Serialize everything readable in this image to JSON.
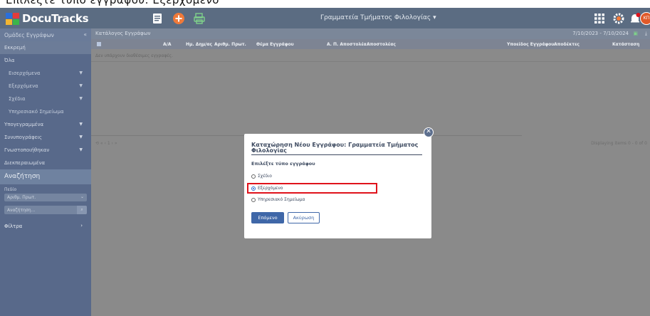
{
  "caption": "Επιλέξτε τύπο εγγράφου: Εξερχόμενο",
  "app": {
    "name": "DocuTracks",
    "department": "Γραμματεία Τμήματος Φιλολογίας ▾",
    "avatar": "ΚΠ"
  },
  "sidebar": {
    "header": "Ομάδες Εγγράφων",
    "items": [
      {
        "label": "Εκκρεμή",
        "active": true
      },
      {
        "label": "Όλα"
      },
      {
        "label": "Εισερχόμενα",
        "sub": true
      },
      {
        "label": "Εξερχόμενα",
        "sub": true
      },
      {
        "label": "Σχέδια",
        "sub": true
      },
      {
        "label": "Υπηρεσιακό Σημείωμα",
        "sub": true
      },
      {
        "label": "Υπογεγραμμένα"
      },
      {
        "label": "Συνυπογράφεις"
      },
      {
        "label": "Γνωστοποιήθηκαν"
      },
      {
        "label": "Διεκπεραιωμένα"
      }
    ],
    "search_section": "Αναζήτηση",
    "field_label": "Πεδίο",
    "field_select": "Αριθμ. Πρωτ.",
    "search_placeholder": "Αναζήτηση...",
    "filters": "Φίλτρα"
  },
  "main": {
    "title": "Κατάλογος Εγγράφων",
    "date_range": "7/10/2023 - 7/10/2024",
    "columns": [
      "Α/Α",
      "Ημ. Δημ/ας",
      "Αριθμ. Πρωτ.",
      "Θέμα Εγγράφου",
      "Α. Π. Αποστολέα",
      "Αποστολέας",
      "Υποείδος Εγγράφου",
      "Αποδέκτες",
      "Κατάσταση"
    ],
    "empty_message": "Δεν υπάρχουν διαθέσιμες εγγραφές.",
    "pager": "⟲  «  ‹  1  ›  »",
    "displaying": "Displaying items 0 - 0 of 0"
  },
  "modal": {
    "title": "Καταχώρηση Νέου Εγγράφου: Γραμματεία Τμήματος Φιλολογίας",
    "prompt": "Επιλέξτε τύπο εγγράφου",
    "options": [
      {
        "label": "Σχέδιο",
        "selected": false
      },
      {
        "label": "Εξερχόμενο",
        "selected": true
      },
      {
        "label": "Υπηρεσιακό Σημείωμα",
        "selected": false
      }
    ],
    "next_label": "Επόμενο",
    "cancel_label": "Ακύρωση",
    "close_symbol": "✕"
  },
  "colors": {
    "topbar": "#5b6c82",
    "sidebar": "#58698a",
    "accent": "#3f67a8",
    "highlight": "#e0121b"
  }
}
